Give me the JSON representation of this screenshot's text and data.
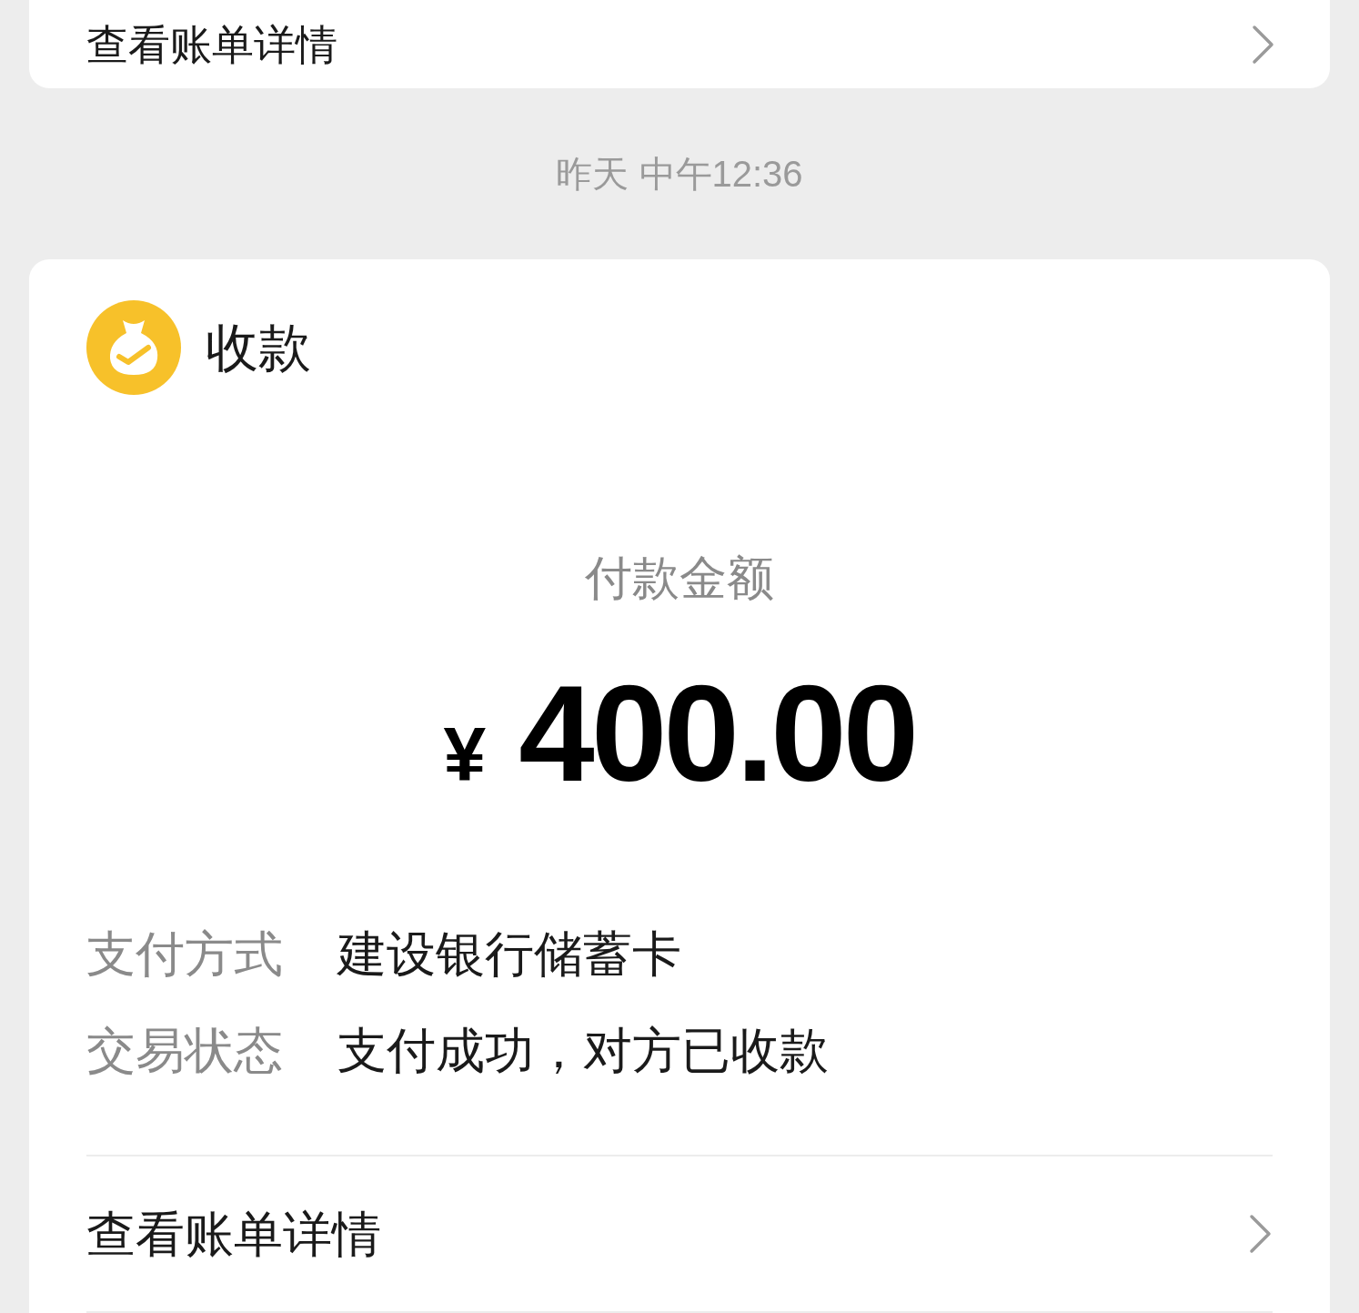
{
  "previous_card": {
    "link": "查看账单详情"
  },
  "timestamp": "昨天 中午12:36",
  "card": {
    "title": "收款",
    "amount_label": "付款金额",
    "currency": "¥",
    "amount": "400.00",
    "details": [
      {
        "label": "支付方式",
        "value": "建设银行储蓄卡"
      },
      {
        "label": "交易状态",
        "value": "支付成功，对方已收款"
      }
    ],
    "link": "查看账单详情"
  }
}
